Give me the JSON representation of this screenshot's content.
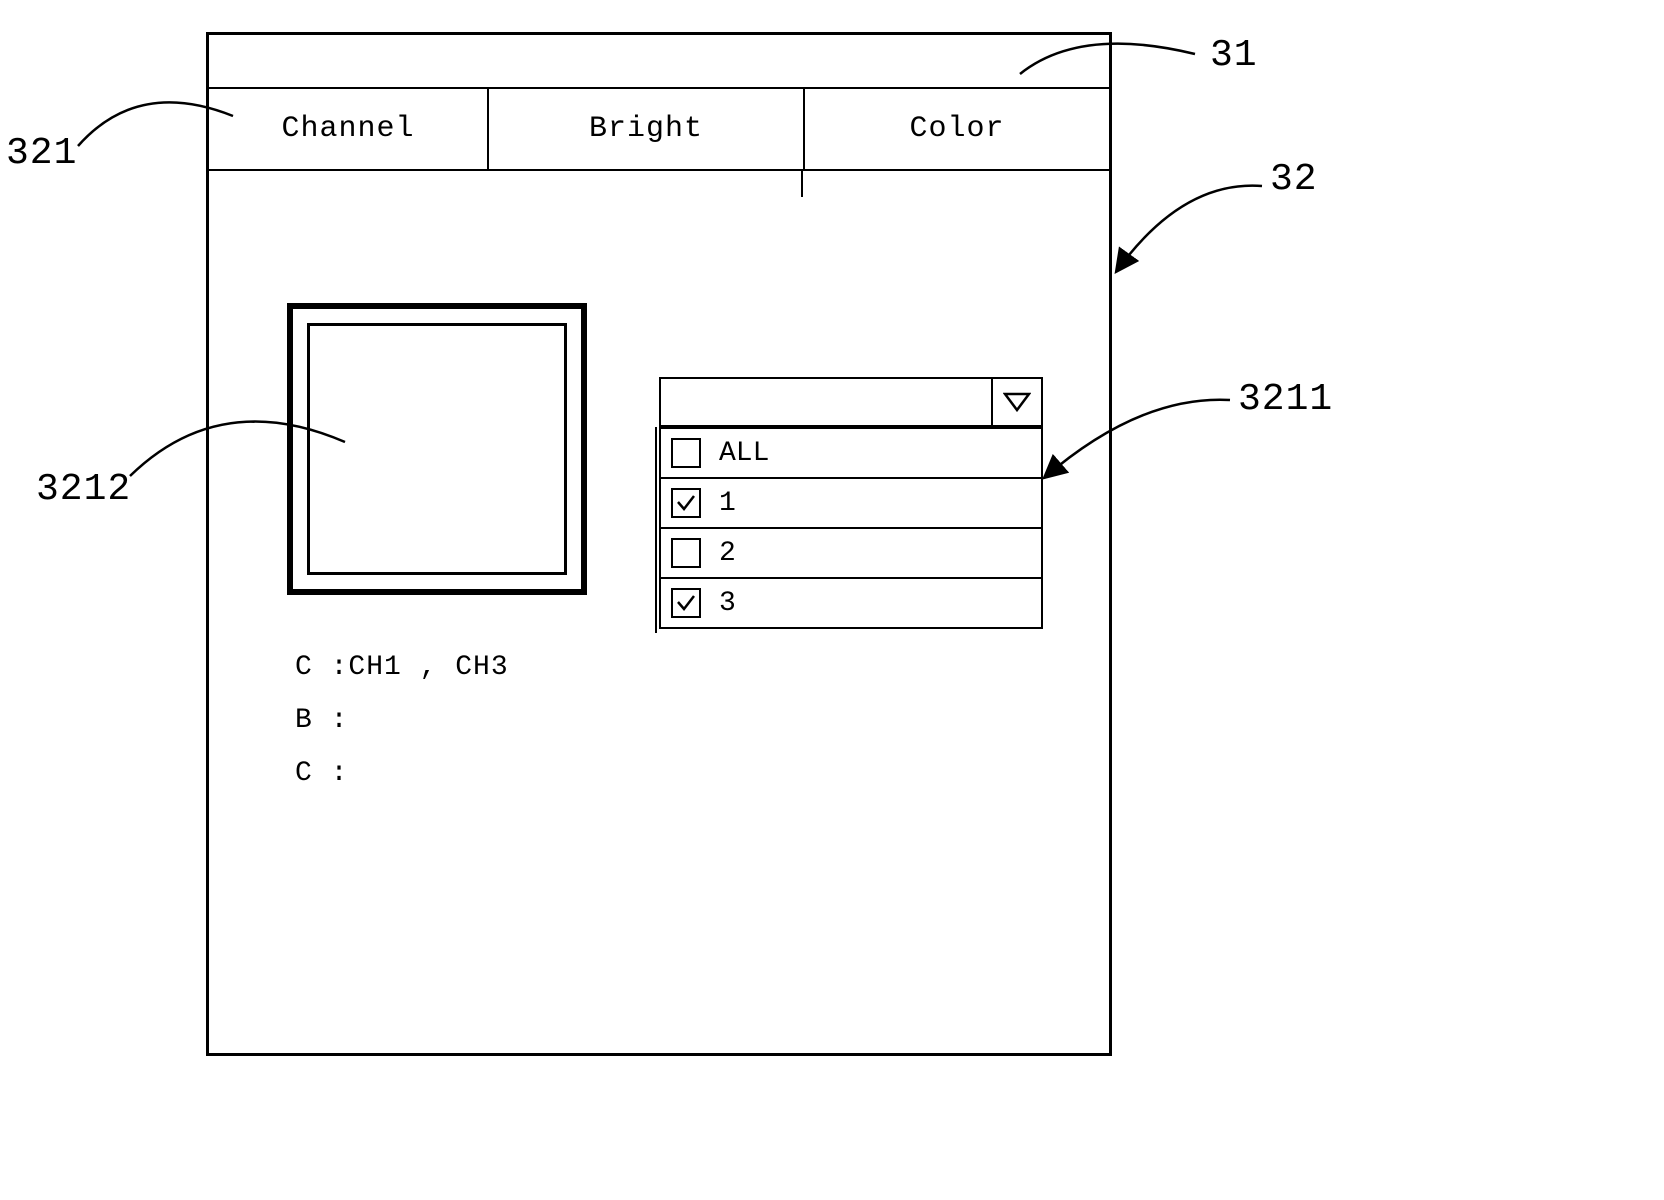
{
  "tabs": {
    "channel": "Channel",
    "bright": "Bright",
    "color": "Color"
  },
  "dropdown": {
    "options": [
      {
        "label": "ALL",
        "checked": false
      },
      {
        "label": "1",
        "checked": true
      },
      {
        "label": "2",
        "checked": false
      },
      {
        "label": "3",
        "checked": true
      }
    ]
  },
  "status": {
    "line1": "C :CH1 , CH3",
    "line2": "B :",
    "line3": "C :"
  },
  "refs": {
    "r31": "31",
    "r32": "32",
    "r321": "321",
    "r3211": "3211",
    "r3212": "3212"
  }
}
